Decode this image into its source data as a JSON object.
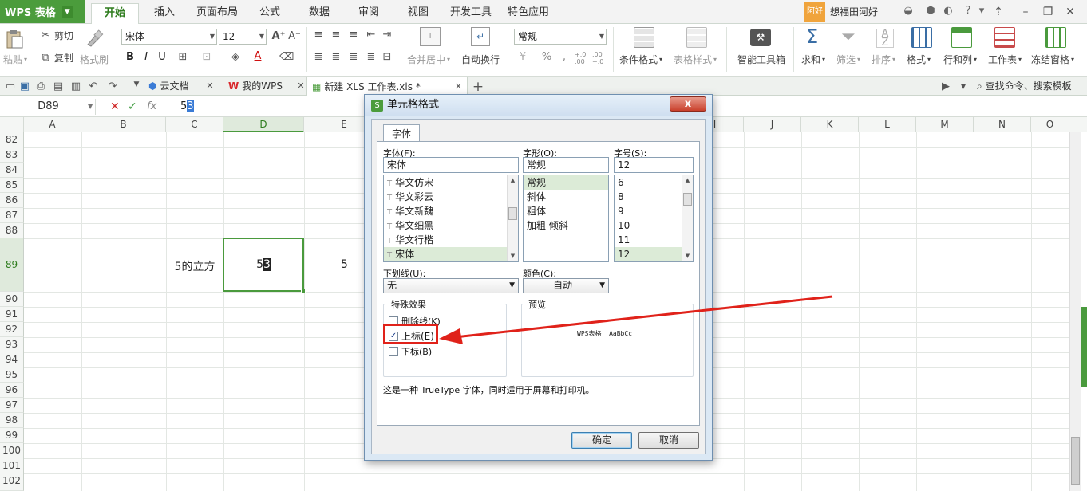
{
  "app": {
    "title": "WPS 表格"
  },
  "menu": {
    "tabs": [
      "开始",
      "插入",
      "页面布局",
      "公式",
      "数据",
      "审阅",
      "视图",
      "开发工具",
      "特色应用"
    ],
    "active": "开始"
  },
  "user": {
    "badge": "阿好",
    "name": "想福田河好"
  },
  "ribbon": {
    "clipboard": {
      "paste": "粘贴",
      "cut": "剪切",
      "copy": "复制",
      "format_painter": "格式刷"
    },
    "font": {
      "name": "宋体",
      "size": "12"
    },
    "align": {
      "merge": "合并居中",
      "wrap": "自动换行"
    },
    "number": {
      "format": "常规"
    },
    "styles": {
      "conditional": "条件格式",
      "table_style": "表格样式"
    },
    "tools": {
      "smart": "智能工具箱"
    },
    "edit": {
      "sum": "求和",
      "filter": "筛选",
      "sort": "排序",
      "format": "格式",
      "rowcol": "行和列",
      "sheet": "工作表",
      "freeze": "冻结窗格"
    }
  },
  "doctabs": [
    {
      "label": "云文档"
    },
    {
      "label": "我的WPS"
    },
    {
      "label": "新建 XLS 工作表.xls *"
    }
  ],
  "doctab_right": {
    "search": "查找命令、搜索模板"
  },
  "formula": {
    "cell_ref": "D89",
    "fx": "fx",
    "value_plain": "5",
    "value_selected": "3"
  },
  "columns": [
    "A",
    "B",
    "C",
    "D",
    "E",
    "I",
    "J",
    "K",
    "L",
    "M",
    "N",
    "O"
  ],
  "rows": [
    "82",
    "83",
    "84",
    "85",
    "86",
    "87",
    "88",
    "89",
    "90",
    "91",
    "92",
    "93",
    "94",
    "95",
    "96",
    "97",
    "98",
    "99",
    "100",
    "101",
    "102"
  ],
  "cells": {
    "c89": "5的立方",
    "d89_base": "5",
    "d89_sup": "3",
    "e89": "5"
  },
  "dialog": {
    "title": "单元格格式",
    "close": "x",
    "tab": "字体",
    "font_label": "字体(F):",
    "font_value": "宋体",
    "fonts": [
      "华文仿宋",
      "华文彩云",
      "华文新魏",
      "华文细黑",
      "华文行楷",
      "宋体"
    ],
    "style_label": "字形(O):",
    "style_value": "常规",
    "styles": [
      "常规",
      "斜体",
      "粗体",
      "加粗 倾斜"
    ],
    "size_label": "字号(S):",
    "size_value": "12",
    "sizes": [
      "6",
      "8",
      "9",
      "10",
      "11",
      "12"
    ],
    "underline_label": "下划线(U):",
    "underline_value": "无",
    "color_label": "颜色(C):",
    "color_value": "自动",
    "effects_label": "特殊效果",
    "strike": "删除线(K)",
    "superscript": "上标(E)",
    "subscript": "下标(B)",
    "preview_label": "预览",
    "preview_text": "WPS表格  AaBbCc",
    "note": "这是一种 TrueType 字体，同时适用于屏幕和打印机。",
    "ok": "确定",
    "cancel": "取消"
  },
  "colors": {
    "brand_green": "#4b9c3c",
    "highlight_red": "#e0221a"
  }
}
